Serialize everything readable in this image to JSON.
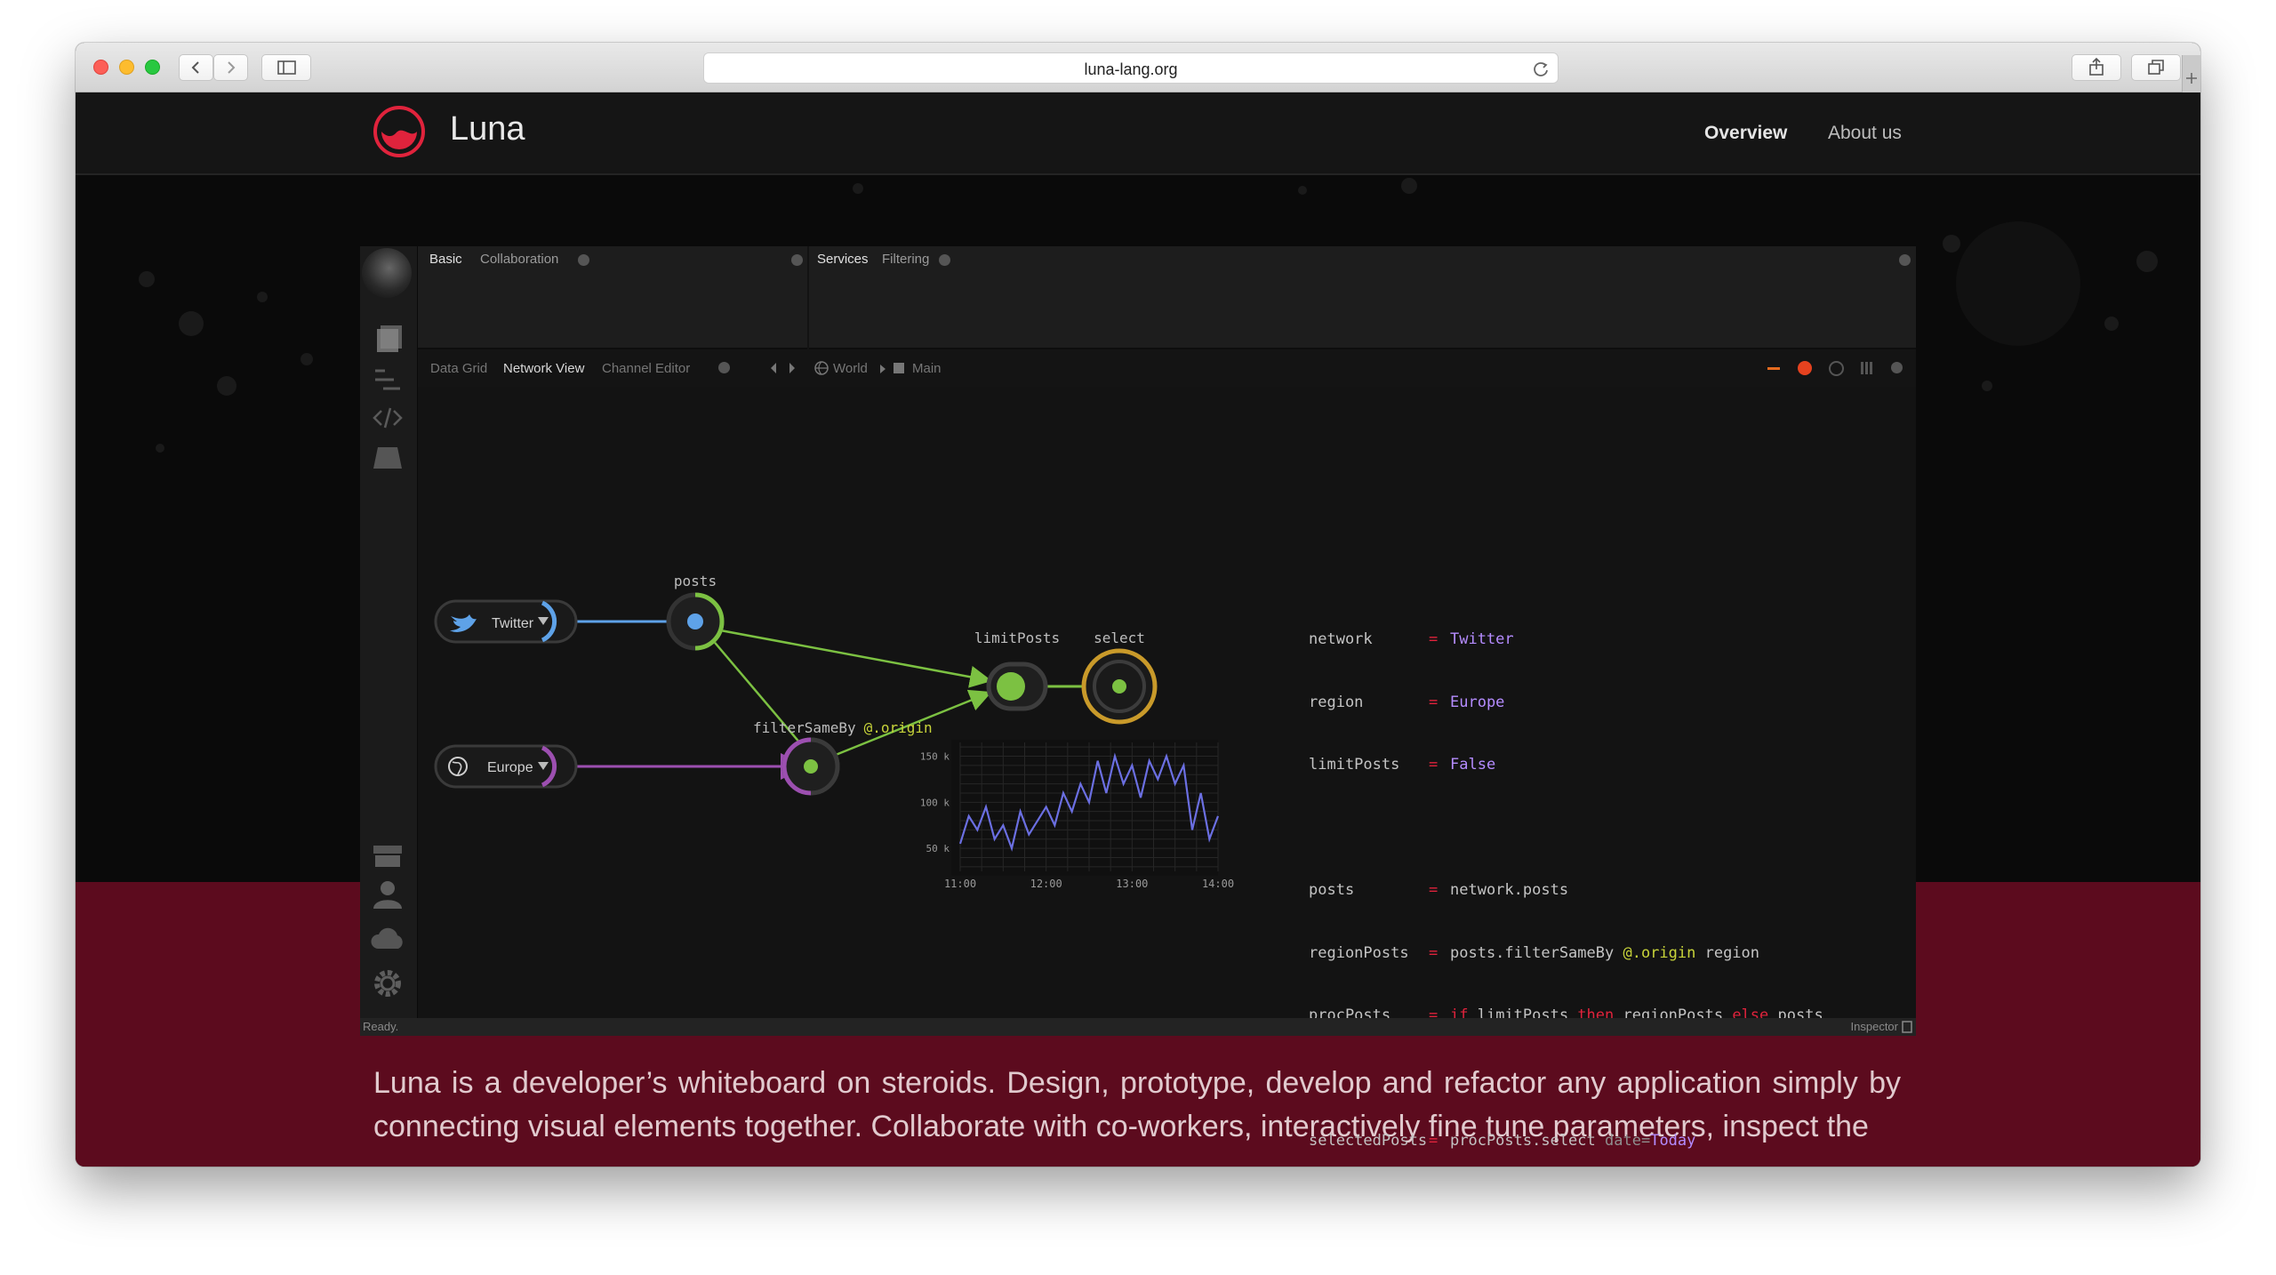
{
  "browser": {
    "url": "luna-lang.org",
    "buttons": [
      "back-icon",
      "forward-icon",
      "sidebar-icon",
      "reload-icon",
      "share-icon",
      "tabs-icon",
      "new-tab-icon"
    ]
  },
  "site": {
    "brand": "Luna",
    "nav": {
      "overview": "Overview",
      "about": "About us"
    },
    "tagline": "Luna is a developer’s whiteboard on steroids. Design, prototype, develop and refactor any application simply by connecting visual elements together. Collaborate with co-workers, interactively fine tune parameters, inspect the"
  },
  "app": {
    "top_left_tabs": [
      "Basic",
      "Collaboration"
    ],
    "top_right_tabs": [
      "Services",
      "Filtering"
    ],
    "sub_tabs": [
      "Data Grid",
      "Network View",
      "Channel Editor"
    ],
    "breadcrumb": [
      "World",
      "Main"
    ],
    "status_left": "Ready.",
    "status_right": "Inspector",
    "nodes": {
      "twitter": "Twitter",
      "europe": "Europe",
      "posts": "posts",
      "limitPosts": "limitPosts",
      "select": "select",
      "filter": "filterSameBy",
      "filter_arg": "@.origin"
    },
    "code": {
      "l1": {
        "name": "network",
        "eq": "=",
        "val": "Twitter"
      },
      "l2": {
        "name": "region",
        "eq": "=",
        "val": "Europe"
      },
      "l3": {
        "name": "limitPosts",
        "eq": "=",
        "val": "False"
      },
      "l4": {
        "name": "posts",
        "eq": "=",
        "val": "network.posts"
      },
      "l5": {
        "name": "regionPosts",
        "eq": "=",
        "pre": "posts.filterSameBy ",
        "arg": "@.origin",
        "post": " region"
      },
      "l6": {
        "name": "procPosts",
        "eq": "=",
        "k_if": "if",
        "a": " limitPosts ",
        "k_then": "then",
        "b": " regionPosts ",
        "k_else": "else",
        "c": " posts"
      },
      "l7": {
        "name": "selectedPosts",
        "eq": "=",
        "pre": "procPosts.select ",
        "param": "date",
        "peq": "=",
        "val": "Today"
      }
    },
    "colors": {
      "accent_red": "#e0233c",
      "maroon": "#5c0b1e",
      "keyword": "#e0233c",
      "value": "#b58cff",
      "green": "#7cc142",
      "blue": "#5ea2e8",
      "purple": "#9c4fb0",
      "gold": "#c99a2a"
    }
  },
  "chart_data": {
    "type": "line",
    "title": "",
    "y_ticks": [
      "150 k",
      "100 k",
      "50 k"
    ],
    "x_ticks": [
      "11:00",
      "12:00",
      "13:00",
      "14:00"
    ],
    "ylim": [
      25,
      165
    ],
    "x_hours": [
      11.0,
      11.1,
      11.2,
      11.3,
      11.4,
      11.5,
      11.6,
      11.7,
      11.8,
      11.9,
      12.0,
      12.1,
      12.2,
      12.3,
      12.4,
      12.5,
      12.6,
      12.7,
      12.8,
      12.9,
      13.0,
      13.1,
      13.2,
      13.3,
      13.4,
      13.5,
      13.6,
      13.7,
      13.8,
      13.9,
      14.0
    ],
    "series": [
      {
        "values": [
          55,
          85,
          70,
          95,
          60,
          75,
          50,
          90,
          65,
          80,
          95,
          75,
          110,
          90,
          120,
          100,
          145,
          110,
          150,
          120,
          140,
          105,
          145,
          125,
          150,
          120,
          140,
          70,
          110,
          60,
          85
        ]
      }
    ]
  }
}
